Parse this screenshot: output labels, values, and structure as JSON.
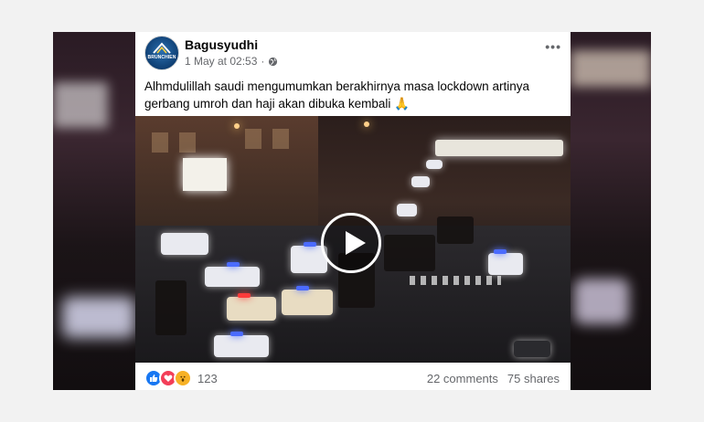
{
  "post": {
    "author": "Bagusyudhi",
    "avatar_text": "BRUNCHIEN",
    "date": "1 May at 02:53",
    "caption": "Alhmdulillah saudi mengumumkan berakhirnya masa lockdown artinya gerbang umroh dan haji akan dibuka kembali",
    "caption_emoji": "🙏",
    "more_label": "•••",
    "privacy_icon": "globe-icon",
    "reaction_count": "123",
    "comments": "22 comments",
    "shares": "75 shares"
  },
  "video": {
    "play_icon": "play-icon"
  },
  "colors": {
    "like": "#1877f2",
    "love": "#f33e58",
    "wow": "#f7b125",
    "meta_text": "#65676b"
  }
}
